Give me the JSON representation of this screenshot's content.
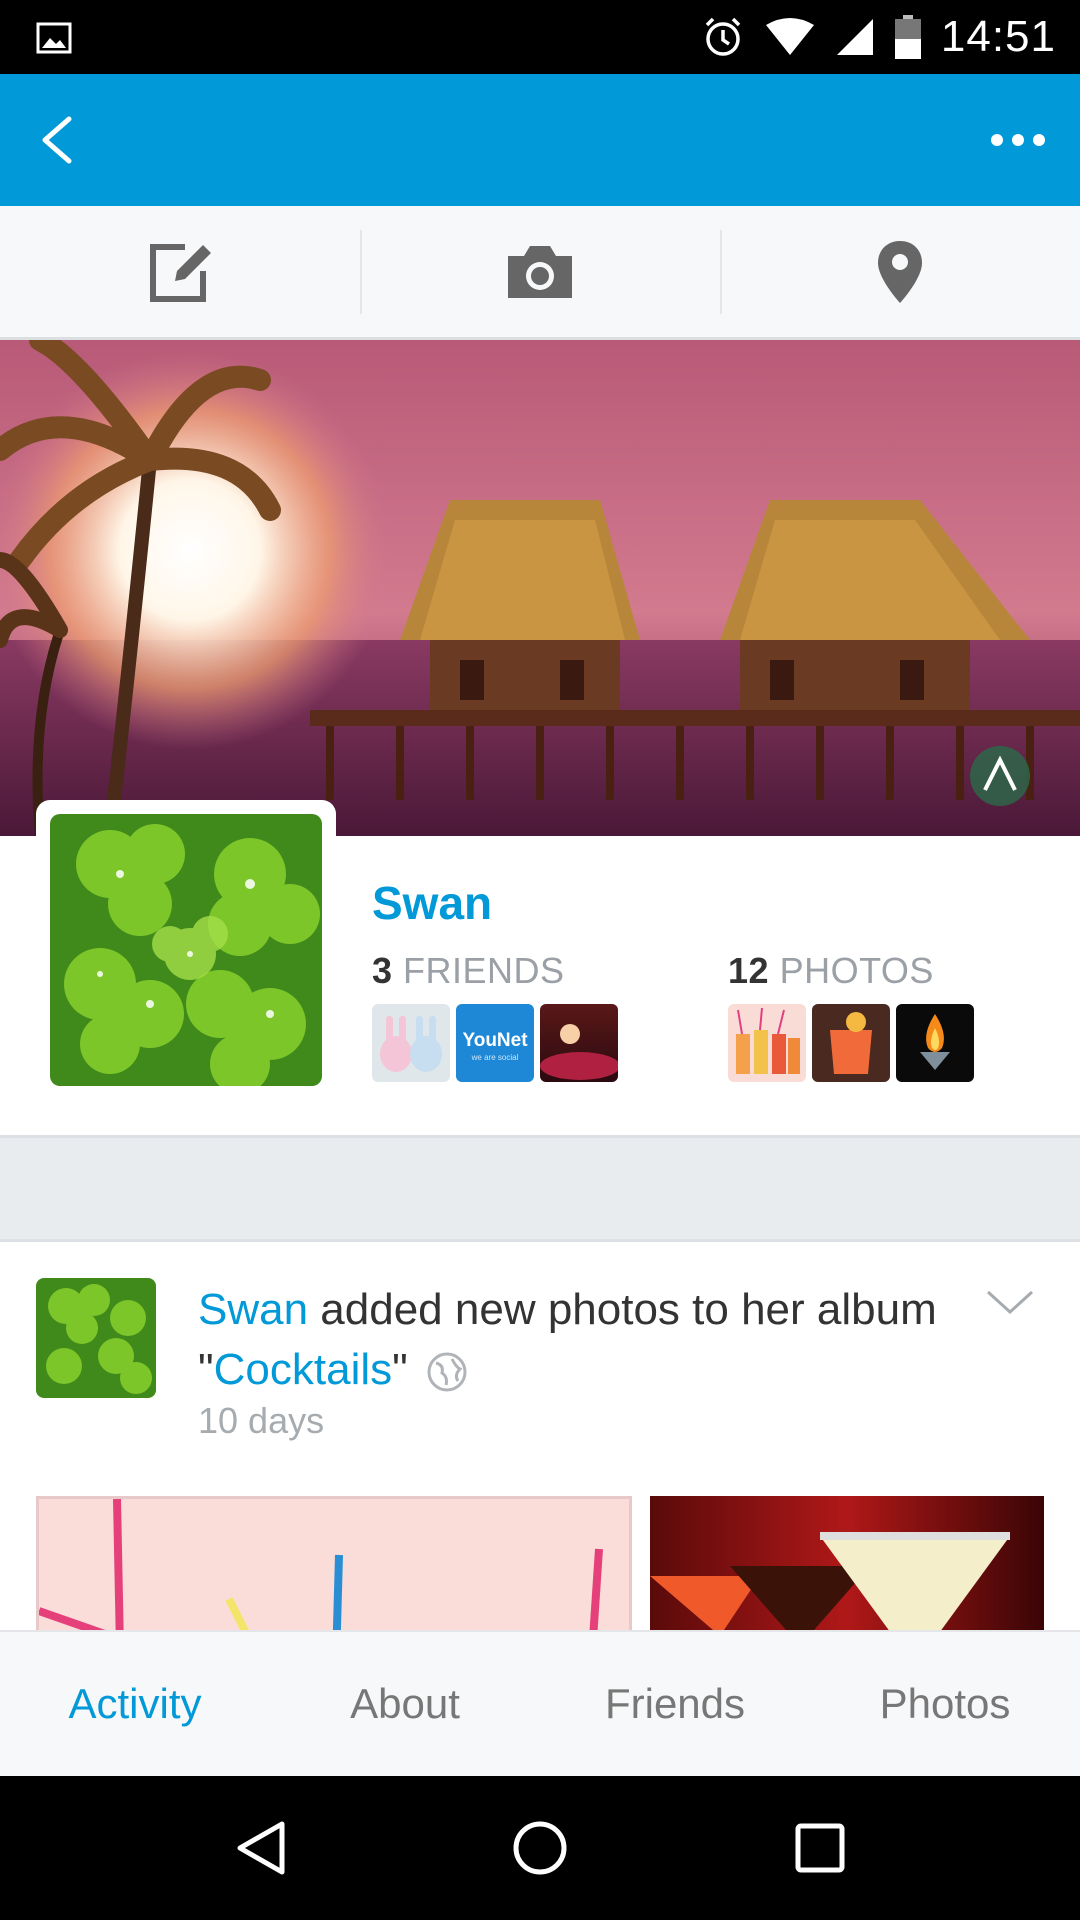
{
  "status_bar": {
    "time": "14:51",
    "icons": [
      "image-icon",
      "alarm-icon",
      "wifi-icon",
      "signal-icon",
      "battery-icon"
    ]
  },
  "app_bar": {
    "color": "#0199d7",
    "icons": [
      "back-arrow-icon",
      "more-dots-icon"
    ]
  },
  "actions": {
    "icons": [
      "edit-status-icon",
      "camera-icon",
      "location-pin-icon"
    ]
  },
  "profile": {
    "name": "Swan",
    "friends_count": "3",
    "friends_label": "FRIENDS",
    "photos_count": "12",
    "photos_label": "PHOTOS",
    "friend_thumbs": [
      "bunnies",
      "YouNet",
      "sunset"
    ],
    "photo_thumbs": [
      "cocktail-glasses",
      "orange-cocktail",
      "flaming-cocktail"
    ],
    "younet_text": "YouNet",
    "younet_sub": "we are social"
  },
  "feed": {
    "actor": "Swan",
    "action_text": " added new photos to her album",
    "quote_open": "\"",
    "album": "Cocktails",
    "quote_close": "\"",
    "time": "10 days"
  },
  "tabs": {
    "activity": "Activity",
    "about": "About",
    "friends": "Friends",
    "photos": "Photos",
    "active": "Activity"
  },
  "nav_bar": {
    "icons": [
      "back-triangle-icon",
      "home-circle-icon",
      "recents-square-icon"
    ]
  }
}
